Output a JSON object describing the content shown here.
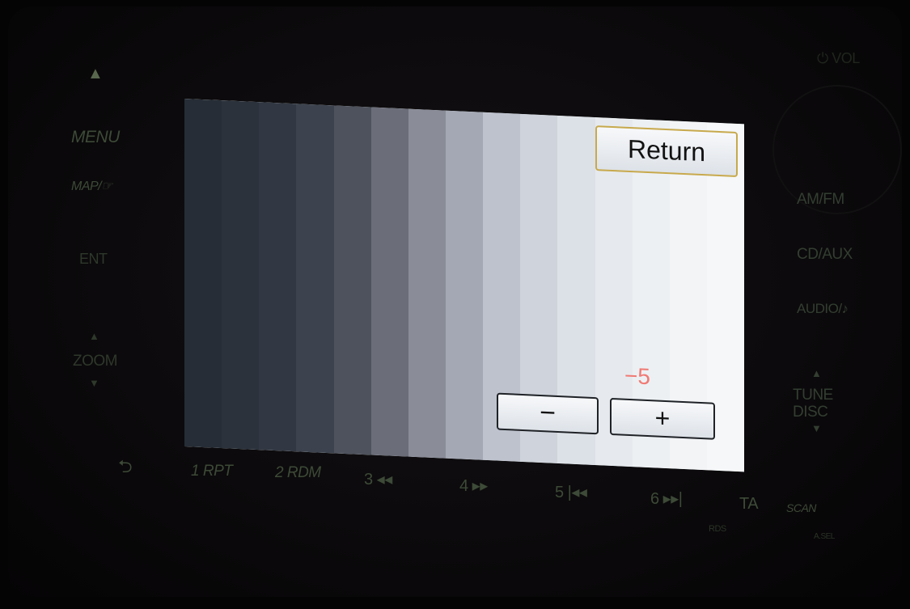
{
  "colors": {
    "grayscale_bars": [
      "#262d36",
      "#2b323b",
      "#323843",
      "#3d434e",
      "#4d525c",
      "#6b6e79",
      "#8a8d98",
      "#a4a8b4",
      "#bec2cd",
      "#cfd4dc",
      "#dce1e7",
      "#e6eaee",
      "#edf0f3",
      "#f2f4f6",
      "#f5f7f8"
    ],
    "value_text": "#f07a74",
    "return_border": "#c7a94c"
  },
  "screen": {
    "return_label": "Return",
    "value": "−5",
    "minus_label": "−",
    "plus_label": "+"
  },
  "hardware": {
    "eject_label": "▲",
    "menu_label": "MENU",
    "map_label": "MAP/☞",
    "ent_label": "ENT",
    "zoom_up": "▲",
    "zoom_label": "ZOOM",
    "zoom_down": "▼",
    "back_label": "⮌",
    "power_vol_label": "⏻ VOL",
    "amfm_label": "AM/FM",
    "cdaux_label": "CD/AUX",
    "audio_label": "AUDIO/♪",
    "tune_up": "▲",
    "tune_label": "TUNE",
    "disc_label": "DISC",
    "tune_down": "▼",
    "presets": [
      "1 RPT",
      "2 RDM",
      "3 ◂◂",
      "4 ▸▸",
      "5 |◂◂",
      "6 ▸▸|"
    ],
    "ta_label": "TA",
    "rds_label": "RDS",
    "scan_label": "SCAN",
    "asel_label": "A.SEL"
  }
}
